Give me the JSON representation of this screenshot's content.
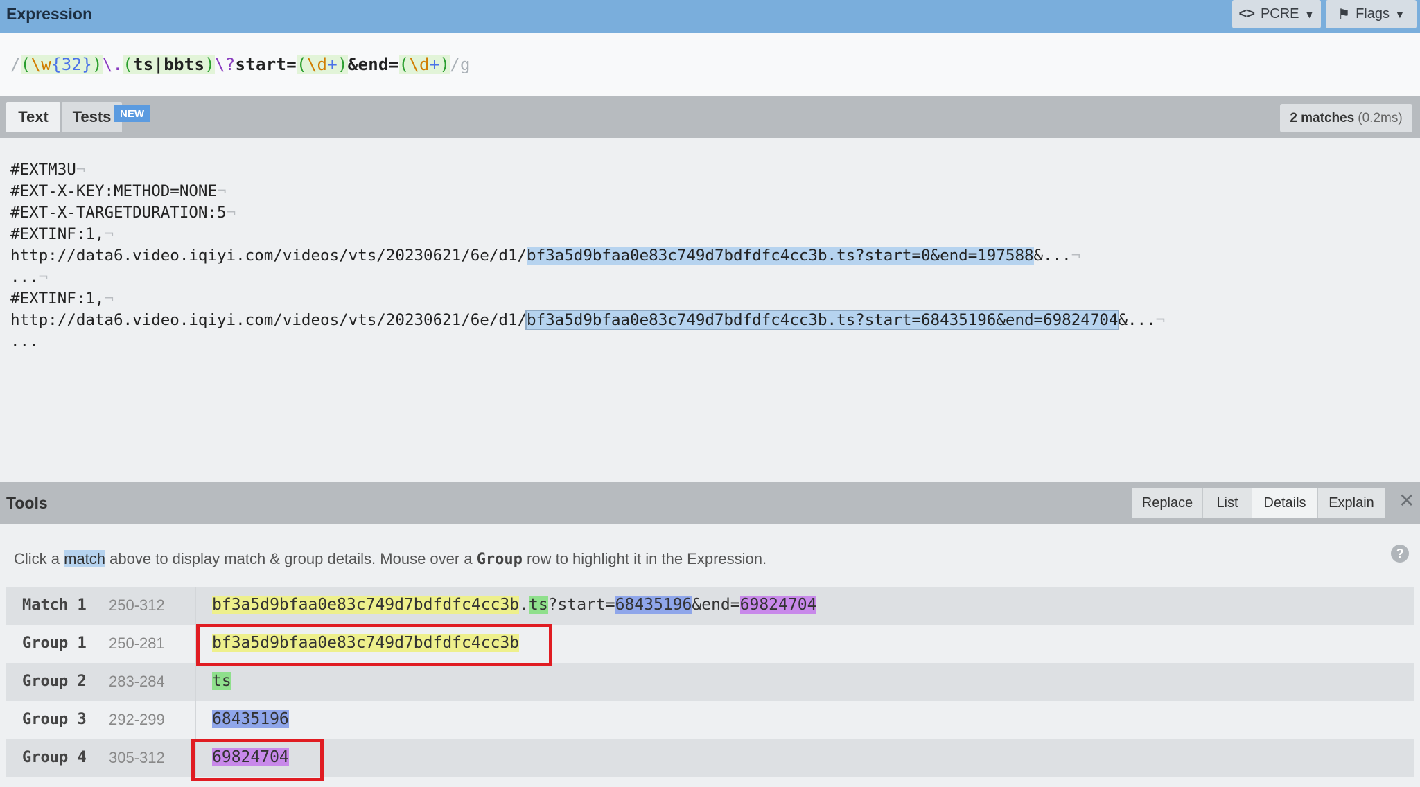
{
  "header": {
    "title": "Expression",
    "pcre_label": "PCRE",
    "flags_label": "Flags"
  },
  "expression": {
    "open_delim": "/",
    "g1_open": "(",
    "g1_class": "\\w",
    "g1_quant": "{32}",
    "g1_close": ")",
    "esc_dot": "\\.",
    "g2_open": "(",
    "g2_a": "ts",
    "g2_alt": "|",
    "g2_b": "bbts",
    "g2_close": ")",
    "esc_q": "\\?",
    "lit_start": "start=",
    "g3_open": "(",
    "g3_class": "\\d",
    "g3_quant": "+",
    "g3_close": ")",
    "lit_end": "&end=",
    "g4_open": "(",
    "g4_class": "\\d",
    "g4_quant": "+",
    "g4_close": ")",
    "close_delim": "/",
    "flags": "g"
  },
  "tabs": {
    "text": "Text",
    "tests": "Tests",
    "new_badge": "NEW",
    "match_count": "2 matches",
    "match_time": "(0.2ms)"
  },
  "text_lines": {
    "l1": "#EXTM3U",
    "l2": "#EXT-X-KEY:METHOD=NONE",
    "l3": "#EXT-X-TARGETDURATION:5",
    "l4": "#EXTINF:1,",
    "l5_pre": "http://data6.video.iqiyi.com/videos/vts/20230621/6e/d1/",
    "l5_match": "bf3a5d9bfaa0e83c749d7bdfdfc4cc3b.ts?start=0&end=197588",
    "l5_post": "&...",
    "l6": "...",
    "l7": "#EXTINF:1,",
    "l8_pre": "http://data6.video.iqiyi.com/videos/vts/20230621/6e/d1/",
    "l8_match": "bf3a5d9bfaa0e83c749d7bdfdfc4cc3b.ts?start=68435196&end=69824704",
    "l8_post": "&...",
    "l9": "...",
    "pilcrow": "¬"
  },
  "tools": {
    "title": "Tools",
    "tabs": [
      "Replace",
      "List",
      "Details",
      "Explain"
    ],
    "close": "✕"
  },
  "details": {
    "hint_pre": "Click a ",
    "hint_match": "match",
    "hint_mid": " above to display match & group details. Mouse over a ",
    "hint_group": "Group",
    "hint_post": " row to highlight it in the Expression.",
    "help": "?",
    "match": {
      "label": "Match 1",
      "range": "250-312",
      "g1": "bf3a5d9bfaa0e83c749d7bdfdfc4cc3b",
      "dot": ".",
      "g2": "ts",
      "lit1": "?start=",
      "g3": "68435196",
      "lit2": "&end=",
      "g4": "69824704"
    },
    "groups": [
      {
        "label": "Group 1",
        "range": "250-281",
        "value": "bf3a5d9bfaa0e83c749d7bdfdfc4cc3b"
      },
      {
        "label": "Group 2",
        "range": "283-284",
        "value": "ts"
      },
      {
        "label": "Group 3",
        "range": "292-299",
        "value": "68435196"
      },
      {
        "label": "Group 4",
        "range": "305-312",
        "value": "69824704"
      }
    ]
  },
  "colors": {
    "header_bg": "#7aaedc",
    "group1": "#eef08c",
    "group2": "#8fe08c",
    "group3": "#8fa6ea",
    "group4": "#c889ea",
    "annotation": "#e01c22"
  }
}
